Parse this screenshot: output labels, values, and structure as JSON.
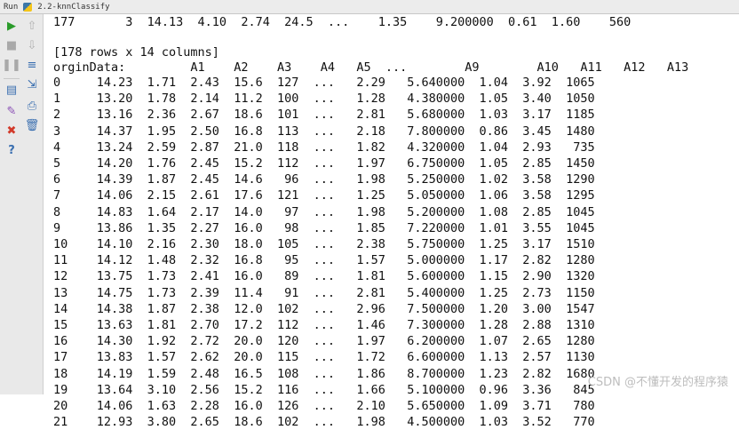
{
  "window": {
    "run_label": "Run",
    "tab_title": "2.2-knnClassify"
  },
  "toolbar": {
    "icons": [
      "run-icon",
      "stop-icon",
      "pause-icon",
      "up-arrow-icon",
      "down-arrow-icon",
      "soft-wrap-icon",
      "layout-icon",
      "print-icon",
      "pin-icon",
      "close-icon",
      "help-icon",
      "trash-icon"
    ]
  },
  "console": {
    "prev_row": "177       3  14.13  4.10  2.74  24.5  ...    1.35    9.200000  0.61  1.60    560",
    "summary": "[178 rows x 14 columns]",
    "header": "orginData:         A1    A2    A3    A4   A5  ...        A9        A10   A11   A12   A13",
    "rows": [
      "0     14.23  1.71  2.43  15.6  127  ...   2.29   5.640000  1.04  3.92  1065",
      "1     13.20  1.78  2.14  11.2  100  ...   1.28   4.380000  1.05  3.40  1050",
      "2     13.16  2.36  2.67  18.6  101  ...   2.81   5.680000  1.03  3.17  1185",
      "3     14.37  1.95  2.50  16.8  113  ...   2.18   7.800000  0.86  3.45  1480",
      "4     13.24  2.59  2.87  21.0  118  ...   1.82   4.320000  1.04  2.93   735",
      "5     14.20  1.76  2.45  15.2  112  ...   1.97   6.750000  1.05  2.85  1450",
      "6     14.39  1.87  2.45  14.6   96  ...   1.98   5.250000  1.02  3.58  1290",
      "7     14.06  2.15  2.61  17.6  121  ...   1.25   5.050000  1.06  3.58  1295",
      "8     14.83  1.64  2.17  14.0   97  ...   1.98   5.200000  1.08  2.85  1045",
      "9     13.86  1.35  2.27  16.0   98  ...   1.85   7.220000  1.01  3.55  1045",
      "10    14.10  2.16  2.30  18.0  105  ...   2.38   5.750000  1.25  3.17  1510",
      "11    14.12  1.48  2.32  16.8   95  ...   1.57   5.000000  1.17  2.82  1280",
      "12    13.75  1.73  2.41  16.0   89  ...   1.81   5.600000  1.15  2.90  1320",
      "13    14.75  1.73  2.39  11.4   91  ...   2.81   5.400000  1.25  2.73  1150",
      "14    14.38  1.87  2.38  12.0  102  ...   2.96   7.500000  1.20  3.00  1547",
      "15    13.63  1.81  2.70  17.2  112  ...   1.46   7.300000  1.28  2.88  1310",
      "16    14.30  1.92  2.72  20.0  120  ...   1.97   6.200000  1.07  2.65  1280",
      "17    13.83  1.57  2.62  20.0  115  ...   1.72   6.600000  1.13  2.57  1130",
      "18    14.19  1.59  2.48  16.5  108  ...   1.86   8.700000  1.23  2.82  1680",
      "19    13.64  3.10  2.56  15.2  116  ...   1.66   5.100000  0.96  3.36   845",
      "20    14.06  1.63  2.28  16.0  126  ...   2.10   5.650000  1.09  3.71   780",
      "21    12.93  3.80  2.65  18.6  102  ...   1.98   4.500000  1.03  3.52   770"
    ]
  },
  "watermark": "CSDN @不懂开发的程序猿"
}
